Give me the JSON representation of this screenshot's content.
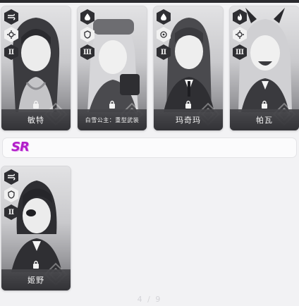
{
  "cards": [
    {
      "name": "敏特",
      "element_icon": "wind-icon",
      "class_icon": "gear-icon",
      "burst_level": "Ⅱ"
    },
    {
      "name": "白雪公主：重型武装",
      "element_icon": "water-icon",
      "class_icon": "shield-icon",
      "burst_level": "Ⅲ"
    },
    {
      "name": "玛奇玛",
      "element_icon": "water-icon",
      "class_icon": "target-icon",
      "burst_level": "Ⅱ"
    },
    {
      "name": "帕瓦",
      "element_icon": "fire-icon",
      "class_icon": "gear-icon",
      "burst_level": "Ⅲ"
    },
    {
      "name": "姬野",
      "element_icon": "wind-icon",
      "class_icon": "shield-icon",
      "burst_level": "Ⅱ"
    }
  ],
  "rarity_section": {
    "label": "SR",
    "color": "#b21fc9"
  },
  "pager": {
    "text": "4 / 9"
  }
}
